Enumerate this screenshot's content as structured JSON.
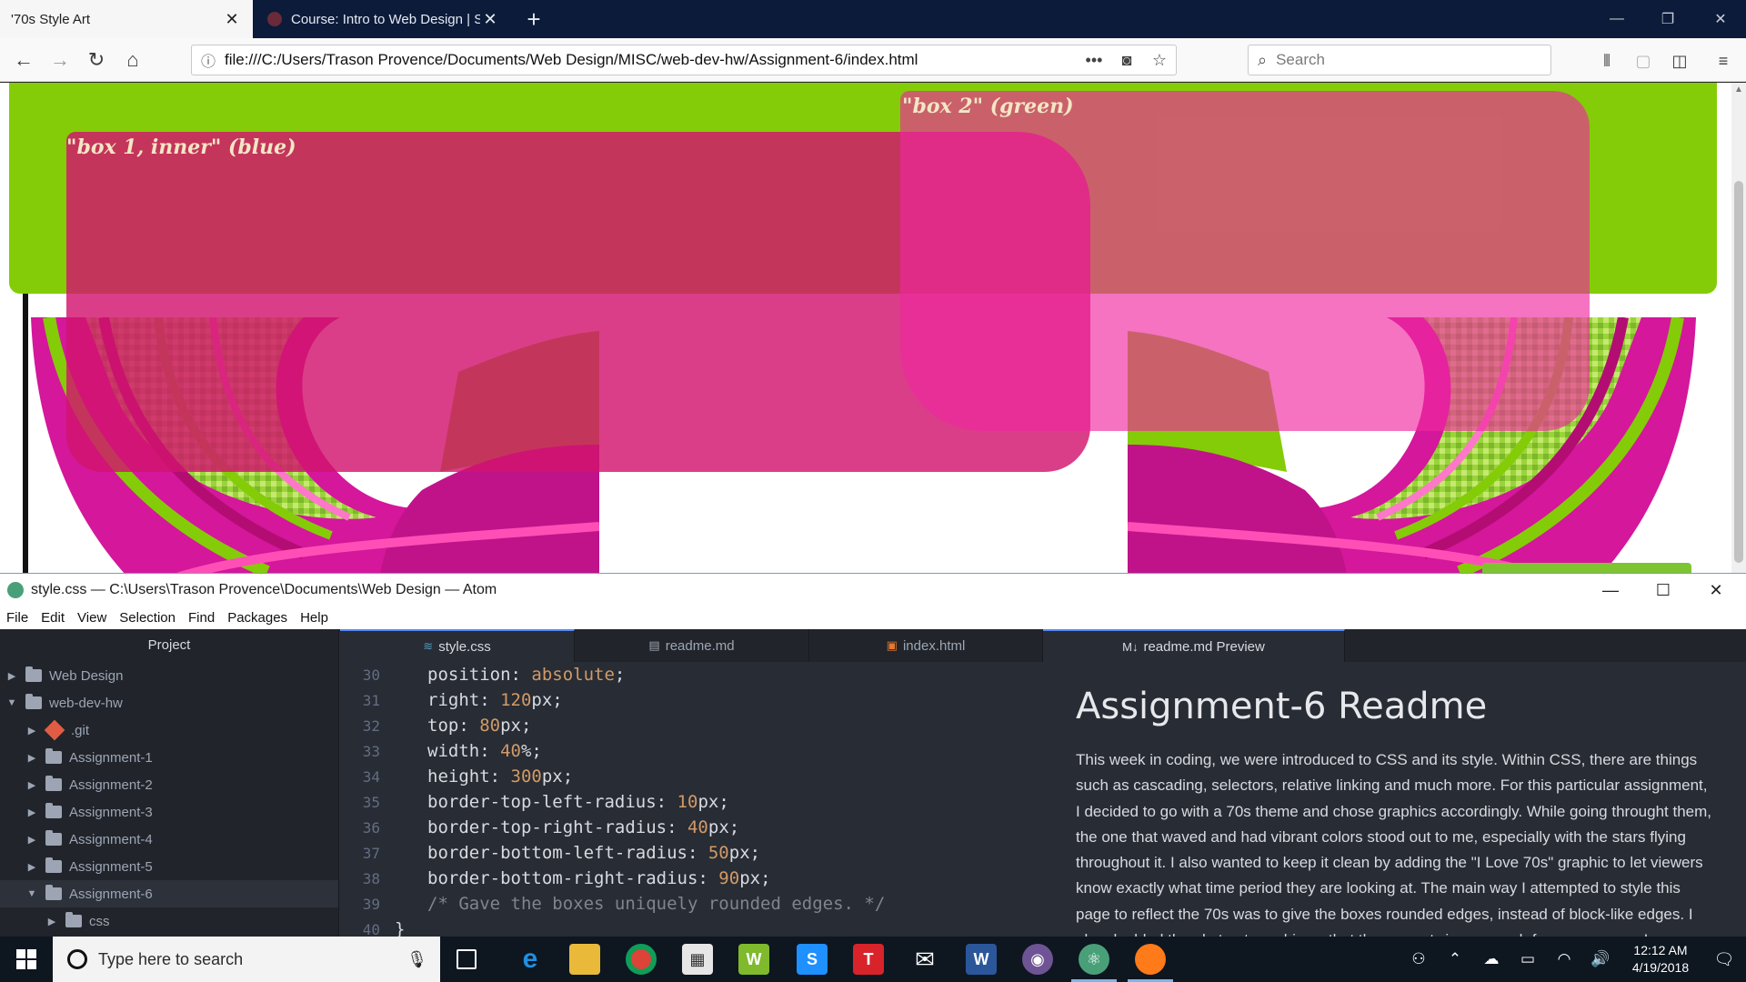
{
  "browser": {
    "tabs": [
      {
        "title": "'70s Style Art",
        "active": true
      },
      {
        "title": "Course: Intro to Web Design | S",
        "active": false
      }
    ],
    "url": "file:///C:/Users/Trason Provence/Documents/Web Design/MISC/web-dev-hw/Assignment-6/index.html",
    "search_placeholder": "Search"
  },
  "page": {
    "box_inner_label": "\"box 1, inner\" (blue)",
    "box_two_label": "\"box 2\" (green)",
    "colors": {
      "header_green": "#84cc08",
      "box_inner": "#d2146e",
      "box_two": "#f028a0"
    }
  },
  "atom": {
    "title": "style.css — C:\\Users\\Trason Provence\\Documents\\Web Design — Atom",
    "menu": [
      "File",
      "Edit",
      "View",
      "Selection",
      "Find",
      "Packages",
      "Help"
    ],
    "project_header": "Project",
    "tree": [
      {
        "label": "Web Design",
        "indent": 0,
        "expanded": false,
        "kind": "folder"
      },
      {
        "label": "web-dev-hw",
        "indent": 0,
        "expanded": true,
        "kind": "folder"
      },
      {
        "label": ".git",
        "indent": 1,
        "expanded": false,
        "kind": "git"
      },
      {
        "label": "Assignment-1",
        "indent": 1,
        "expanded": false,
        "kind": "folder"
      },
      {
        "label": "Assignment-2",
        "indent": 1,
        "expanded": false,
        "kind": "folder"
      },
      {
        "label": "Assignment-3",
        "indent": 1,
        "expanded": false,
        "kind": "folder"
      },
      {
        "label": "Assignment-4",
        "indent": 1,
        "expanded": false,
        "kind": "folder"
      },
      {
        "label": "Assignment-5",
        "indent": 1,
        "expanded": false,
        "kind": "folder"
      },
      {
        "label": "Assignment-6",
        "indent": 1,
        "expanded": true,
        "kind": "folder"
      },
      {
        "label": "css",
        "indent": 2,
        "expanded": false,
        "kind": "folder"
      }
    ],
    "tabs": [
      {
        "label": "style.css",
        "icon": "css-file-icon",
        "active": true
      },
      {
        "label": "readme.md",
        "icon": "markdown-file-icon",
        "active": false
      },
      {
        "label": "index.html",
        "icon": "html-file-icon",
        "active": false
      },
      {
        "label": "readme.md Preview",
        "icon": "markdown-preview-icon",
        "active": true
      }
    ],
    "code": [
      {
        "n": "30",
        "prop": "position: ",
        "val": "absolute",
        "tail": ";"
      },
      {
        "n": "31",
        "prop": "right: ",
        "val": "120",
        "tail": "px;"
      },
      {
        "n": "32",
        "prop": "top: ",
        "val": "80",
        "tail": "px;"
      },
      {
        "n": "33",
        "prop": "width: ",
        "val": "40",
        "tail": "%;"
      },
      {
        "n": "34",
        "prop": "height: ",
        "val": "300",
        "tail": "px;"
      },
      {
        "n": "35",
        "prop": "border-top-left-radius: ",
        "val": "10",
        "tail": "px;"
      },
      {
        "n": "36",
        "prop": "border-top-right-radius: ",
        "val": "40",
        "tail": "px;"
      },
      {
        "n": "37",
        "prop": "border-bottom-left-radius: ",
        "val": "50",
        "tail": "px;"
      },
      {
        "n": "38",
        "prop": "border-bottom-right-radius: ",
        "val": "90",
        "tail": "px;"
      },
      {
        "n": "39",
        "comment": "/* Gave the boxes uniquely rounded edges. */"
      },
      {
        "n": "40",
        "brace": "}"
      }
    ],
    "preview": {
      "heading": "Assignment-6 Readme",
      "paragraph": "This week in coding, we were introduced to CSS and its style. Within CSS, there are things such as cascading, selectors, relative linking and much more. For this particular assignment, I decided to go with a 70s theme and chose graphics accordingly. While going throught them, the one that waved and had vibrant colors stood out to me, especially with the stars flying throughout it. I also wanted to keep it clean by adding the \"I Love 70s\" graphic to let viewers know exactly what time period they are looking at. The main way I attempted to style this page to reflect the 70s was to give the boxes rounded edges, instead of block-like edges. I also doubled the abstract graphic so that there was twice as much fun on one page!"
    }
  },
  "taskbar": {
    "search_placeholder": "Type here to search",
    "time": "12:12 AM",
    "date": "4/19/2018"
  }
}
